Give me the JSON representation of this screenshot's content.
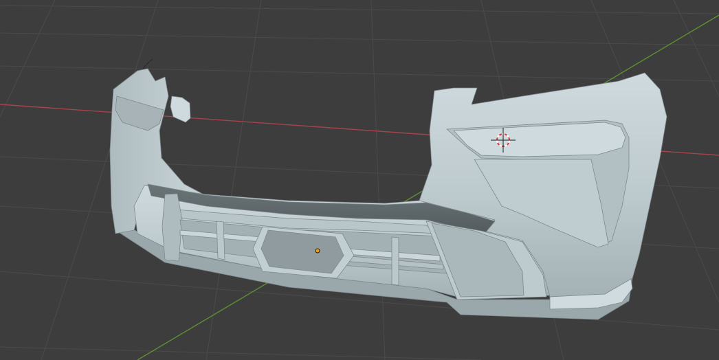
{
  "viewport": {
    "background_color": "#3d3d3d",
    "grid_color": "#4a4a4a",
    "x_axis_color": "#b0414a",
    "y_axis_color": "#6b9b37"
  },
  "scene": {
    "object": "car-front-bumper-mesh",
    "body_color": "#c6d3d7",
    "shadow_color": "#9faaae",
    "dark_color": "#5f686b",
    "origin_color": "#f4a300",
    "cursor_colors": [
      "#d23c3c",
      "#ffffff"
    ]
  }
}
